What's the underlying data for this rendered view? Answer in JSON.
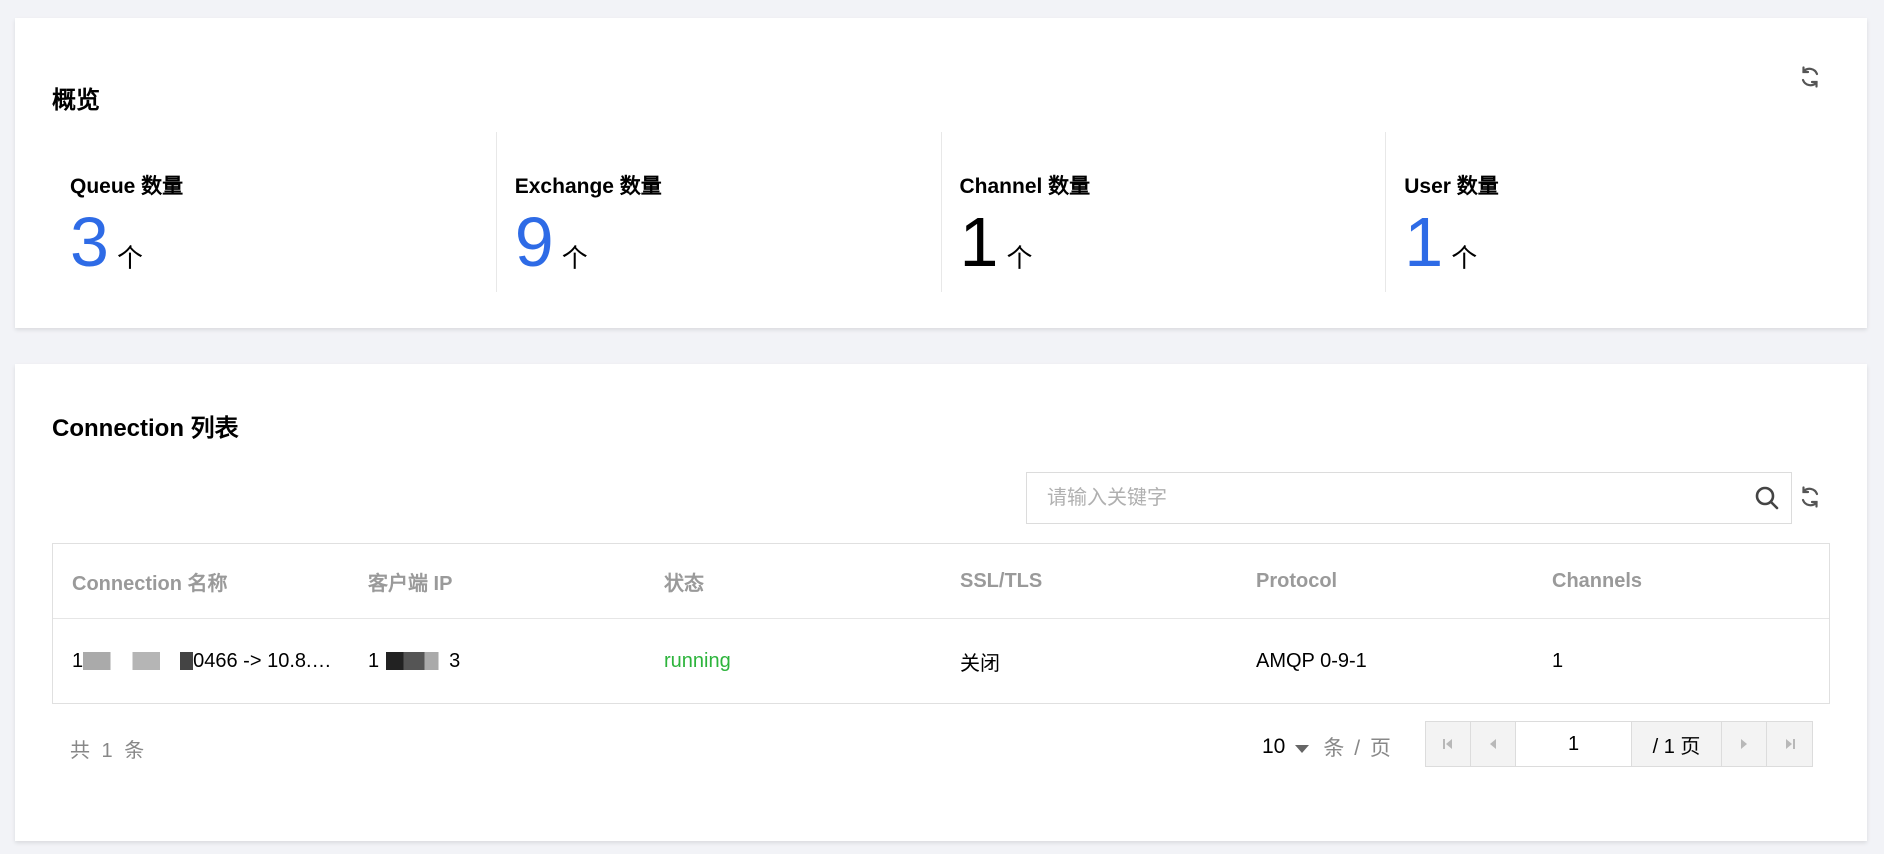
{
  "overview": {
    "title": "概览",
    "stats": [
      {
        "label": "Queue 数量",
        "value": "3",
        "unit": "个",
        "color": "#2e6be6"
      },
      {
        "label": "Exchange 数量",
        "value": "9",
        "unit": "个",
        "color": "#2e6be6"
      },
      {
        "label": "Channel 数量",
        "value": "1",
        "unit": "个",
        "color": "#000000"
      },
      {
        "label": "User 数量",
        "value": "1",
        "unit": "个",
        "color": "#2e6be6"
      }
    ]
  },
  "connections": {
    "title": "Connection 列表",
    "search": {
      "placeholder": "请输入关键字",
      "value": ""
    },
    "columns": [
      "Connection 名称",
      "客户端 IP",
      "状态",
      "SSL/TLS",
      "Protocol",
      "Channels"
    ],
    "rows": [
      {
        "name_prefix": "1",
        "name_suffix": "0466 -> 10.8.…",
        "client_ip_prefix": "1",
        "client_ip_suffix": "3",
        "status": "running",
        "ssl": "关闭",
        "protocol": "AMQP 0-9-1",
        "channels": "1"
      }
    ],
    "pagination": {
      "total_text": "共 1 条",
      "page_size": "10",
      "page_size_unit": "条 / 页",
      "current_page": "1",
      "total_pages_text": "/ 1 页"
    }
  },
  "colors": {
    "accent": "#2e6be6",
    "running": "#2db43c",
    "muted": "#9a9a9a"
  }
}
